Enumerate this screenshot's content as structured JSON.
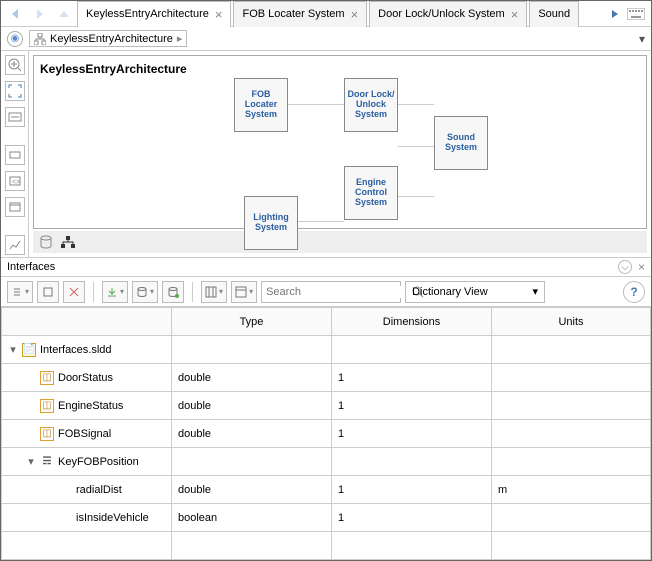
{
  "tabs": [
    {
      "label": "KeylessEntryArchitecture",
      "active": true
    },
    {
      "label": "FOB Locater System",
      "active": false
    },
    {
      "label": "Door Lock/Unlock System",
      "active": false
    },
    {
      "label": "Sound",
      "active": false
    }
  ],
  "breadcrumb": {
    "label": "KeylessEntryArchitecture"
  },
  "canvas": {
    "title": "KeylessEntryArchitecture",
    "blocks": {
      "fob": "FOB Locater System",
      "door": "Door Lock/ Unlock System",
      "sound": "Sound System",
      "engine": "Engine Control System",
      "lighting": "Lighting System"
    }
  },
  "interfaces": {
    "title": "Interfaces",
    "search_placeholder": "Search",
    "view_mode": "Dictionary View",
    "columns": [
      "Type",
      "Dimensions",
      "Units"
    ],
    "root": "Interfaces.sldd",
    "rows": [
      {
        "name": "DoorStatus",
        "type": "double",
        "dims": "1",
        "units": ""
      },
      {
        "name": "EngineStatus",
        "type": "double",
        "dims": "1",
        "units": ""
      },
      {
        "name": "FOBSignal",
        "type": "double",
        "dims": "1",
        "units": ""
      },
      {
        "name": "KeyFOBPosition",
        "type": "",
        "dims": "",
        "units": "",
        "kind": "bus"
      },
      {
        "name": "radialDist",
        "type": "double",
        "dims": "1",
        "units": "m",
        "indent": 3
      },
      {
        "name": "isInsideVehicle",
        "type": "boolean",
        "dims": "1",
        "units": "",
        "indent": 3
      }
    ]
  }
}
